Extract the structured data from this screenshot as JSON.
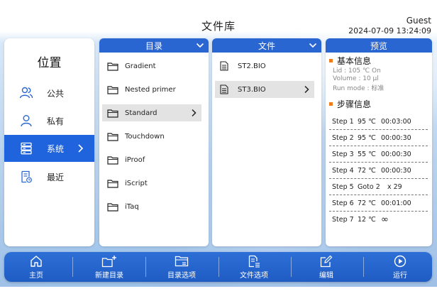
{
  "header": {
    "title": "文件库",
    "user": "Guest",
    "datetime": "2024-07-09 13:24:09"
  },
  "location": {
    "title": "位置",
    "items": [
      {
        "label": "公共",
        "icon": "users-icon"
      },
      {
        "label": "私有",
        "icon": "user-icon"
      },
      {
        "label": "系统",
        "icon": "server-icon",
        "active": true
      },
      {
        "label": "最近",
        "icon": "recent-document-icon"
      }
    ]
  },
  "directory": {
    "header": "目录",
    "items": [
      "Gradient",
      "Nested primer",
      "Standard",
      "Touchdown",
      "iProof",
      "iScript",
      "iTaq"
    ],
    "selected": "Standard"
  },
  "files": {
    "header": "文件",
    "items": [
      "ST2.BIO",
      "ST3.BIO"
    ],
    "selected": "ST3.BIO"
  },
  "preview": {
    "header": "预览",
    "basic_title": "基本信息",
    "lid": "Lid : 105 ℃  On",
    "volume": "Volume : 10 μl",
    "run_mode": "Run mode : 标准",
    "steps_title": "步骤信息",
    "steps": [
      {
        "name": "Step 1",
        "temp": "95 ℃",
        "time": "00:03:00"
      },
      {
        "name": "Step 2",
        "temp": "95 ℃",
        "time": "00:00:30"
      },
      {
        "name": "Step 3",
        "temp": "55 ℃",
        "time": "00:00:30"
      },
      {
        "name": "Step 4",
        "temp": "72 ℃",
        "time": "00:00:30"
      },
      {
        "name": "Step 5",
        "temp": "Goto 2",
        "time": "x 29"
      },
      {
        "name": "Step 6",
        "temp": "72 ℃",
        "time": "00:01:00"
      },
      {
        "name": "Step 7",
        "temp": "12 ℃",
        "time": "∞"
      }
    ]
  },
  "bottom_nav": [
    {
      "label": "主页",
      "icon": "home-icon"
    },
    {
      "label": "新建目录",
      "icon": "new-folder-icon"
    },
    {
      "label": "目录选项",
      "icon": "folder-options-icon"
    },
    {
      "label": "文件选项",
      "icon": "file-options-icon"
    },
    {
      "label": "编辑",
      "icon": "edit-icon"
    },
    {
      "label": "运行",
      "icon": "run-icon"
    }
  ],
  "colors": {
    "accent": "#2a66d2",
    "active_item": "#1f64dc",
    "bullet": "#f07d1a"
  }
}
